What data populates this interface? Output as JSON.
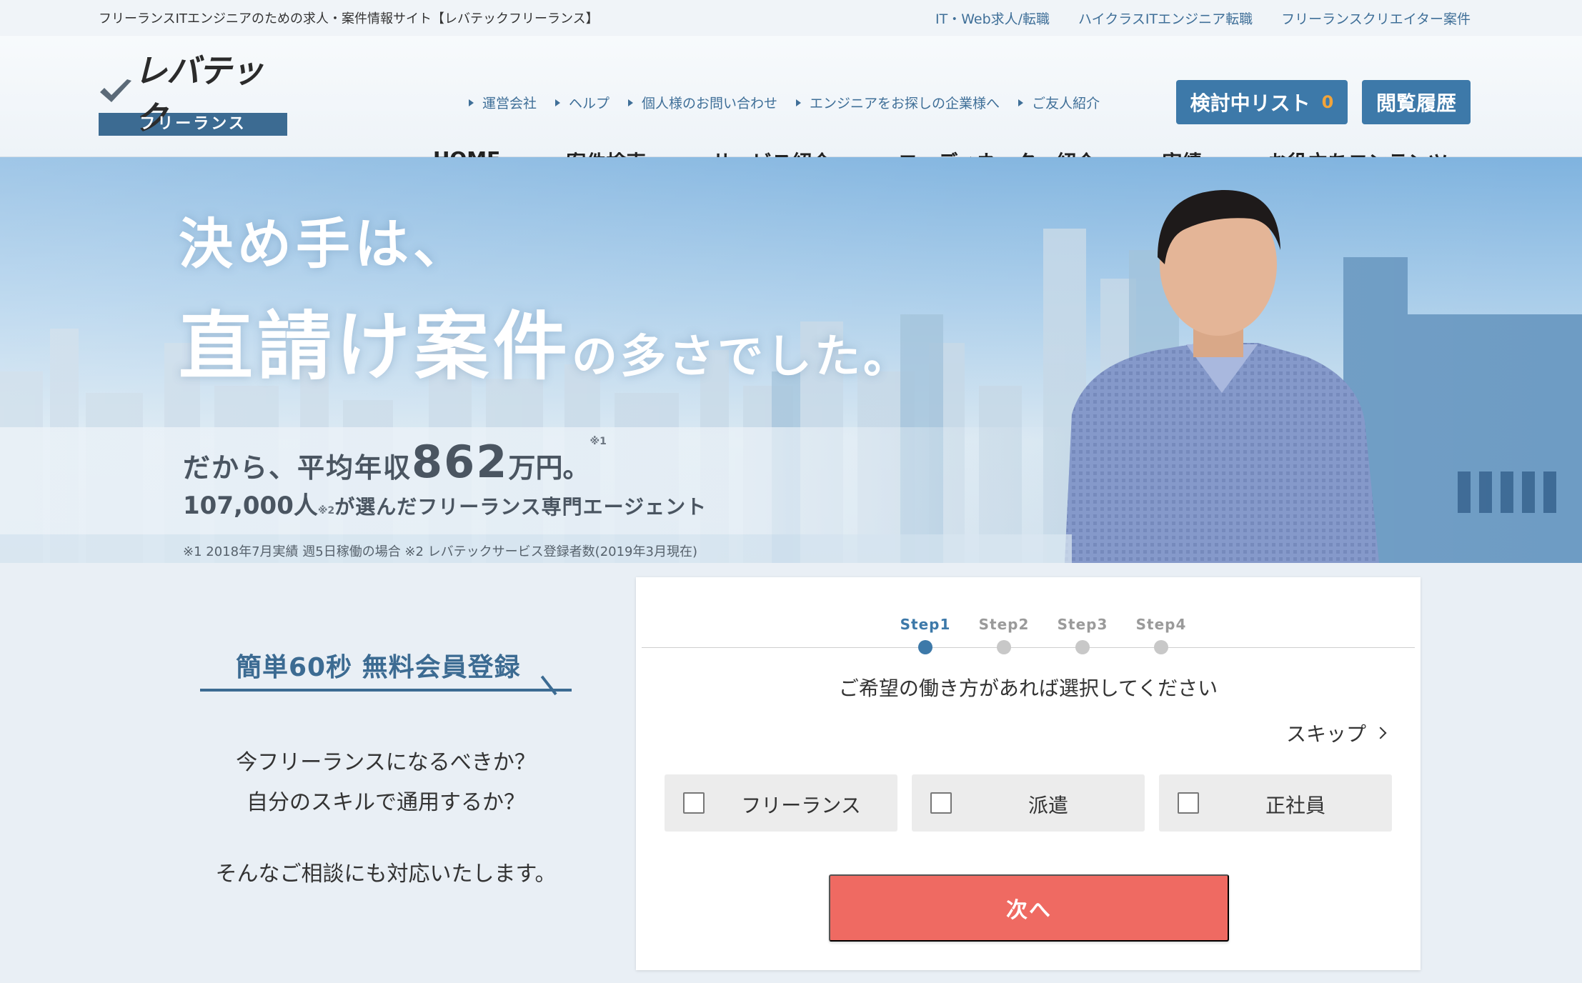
{
  "topbar": {
    "site_description": "フリーランスITエンジニアのための求人・案件情報サイト【レバテックフリーランス】",
    "links": [
      "IT・Web求人/転職",
      "ハイクラスITエンジニア転職",
      "フリーランスクリエイター案件"
    ]
  },
  "header": {
    "logo_main": "レバテック",
    "logo_sub": "フリーランス",
    "sublinks": [
      "運営会社",
      "ヘルプ",
      "個人様のお問い合わせ",
      "エンジニアをお探しの企業様へ",
      "ご友人紹介"
    ],
    "consider_list_label": "検討中リスト",
    "consider_list_count": "0",
    "history_label": "閲覧履歴",
    "nav": [
      "HOME",
      "案件検索",
      "サービス紹介",
      "コーディネーター紹介",
      "実績",
      "お役立ちコンテンツ"
    ],
    "active_nav": "HOME"
  },
  "hero": {
    "line1": "決め手は、",
    "line2_big": "直請け案件",
    "line2_small": "の多さでした。",
    "income_prefix": "だから、平均年収",
    "income_value": "862",
    "income_suffix": "万円。",
    "income_note": "※1",
    "users_value": "107,000人",
    "users_note": "※2",
    "users_text": "が選んだフリーランス専門エージェント",
    "footnote": "※1 2018年7月実績 週5日稼働の場合 ※2 レバテックサービス登録者数(2019年3月現在)"
  },
  "register": {
    "title": "簡単60秒 無料会員登録",
    "lead_line1": "今フリーランスになるべきか？",
    "lead_line2": "自分のスキルで通用するか？",
    "lead_line3": "そんなご相談にも対応いたします。"
  },
  "form": {
    "steps": [
      "Step1",
      "Step2",
      "Step3",
      "Step4"
    ],
    "active_step": 0,
    "question": "ご希望の働き方があれば選択してください",
    "skip_label": "スキップ",
    "options": [
      "フリーランス",
      "派遣",
      "正社員"
    ],
    "next_label": "次へ",
    "colors": {
      "primary": "#3d79a9",
      "next_button": "#ef6a62"
    }
  }
}
